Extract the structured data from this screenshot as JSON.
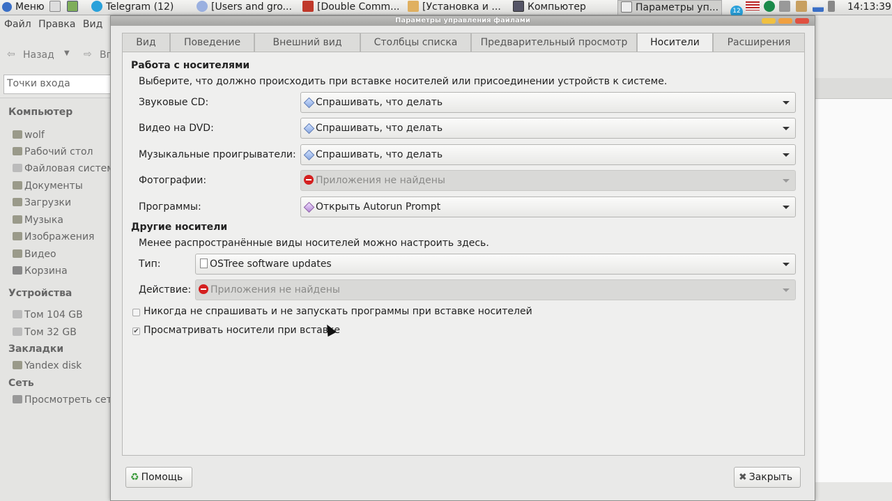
{
  "colors": {
    "accent": "#5a79b6",
    "error": "#d42020",
    "taskbar": "#e8e8e6"
  },
  "taskbar": {
    "menu": "Меню",
    "tasks": [
      "Telegram (12)",
      "[Users and gro...",
      "[Double Comm...",
      "[Установка и ...",
      "Компьютер",
      "Параметры уп..."
    ],
    "tray_badge": "12",
    "clock": "14:13:39"
  },
  "file_manager": {
    "menu": [
      "Файл",
      "Правка",
      "Вид"
    ],
    "back": "Назад",
    "forward_partial": "Вп",
    "places_combo": "Точки входа",
    "sidebar": {
      "computer_header": "Компьютер",
      "computer_items": [
        "wolf",
        "Рабочий стол",
        "Файловая система",
        "Документы",
        "Загрузки",
        "Музыка",
        "Изображения",
        "Видео",
        "Корзина"
      ],
      "devices_header": "Устройства",
      "devices_items": [
        "Том 104 GB",
        "Том 32 GB"
      ],
      "bookmarks_header": "Закладки",
      "bookmarks_items": [
        "Yandex disk"
      ],
      "network_header": "Сеть",
      "network_items": [
        "Просмотреть сеть"
      ]
    }
  },
  "dialog": {
    "title": "Параметры управления файлами",
    "tabs": [
      "Вид",
      "Поведение",
      "Внешний вид",
      "Столбцы списка",
      "Предварительный просмотр",
      "Носители",
      "Расширения"
    ],
    "active_tab": "Носители",
    "media_section": {
      "heading": "Работа с носителями",
      "description": "Выберите, что должно происходить при вставке носителей или присоединении устройств к системе.",
      "rows": [
        {
          "label": "Звуковые CD:",
          "value": "Спрашивать, что делать",
          "icon": "ask-icon",
          "disabled": false
        },
        {
          "label": "Видео на DVD:",
          "value": "Спрашивать, что делать",
          "icon": "ask-icon",
          "disabled": false
        },
        {
          "label": "Музыкальные проигрыватели:",
          "value": "Спрашивать, что делать",
          "icon": "ask-icon",
          "disabled": false
        },
        {
          "label": "Фотографии:",
          "value": "Приложения не найдены",
          "icon": "no-entry-icon",
          "disabled": true
        },
        {
          "label": "Программы:",
          "value": "Открыть Autorun Prompt",
          "icon": "autorun-icon",
          "disabled": false
        }
      ]
    },
    "other_section": {
      "heading": "Другие носители",
      "description": "Менее распространённые виды носителей можно настроить здесь.",
      "type_label": "Тип:",
      "type_value": "OSTree software updates",
      "action_label": "Действие:",
      "action_value": "Приложения не найдены"
    },
    "checkboxes": [
      {
        "label": "Никогда не спрашивать и не запускать программы при вставке носителей",
        "checked": false
      },
      {
        "label": "Просматривать носители при вставке",
        "checked": true
      }
    ],
    "help_button": "Помощь",
    "close_button": "Закрыть"
  }
}
